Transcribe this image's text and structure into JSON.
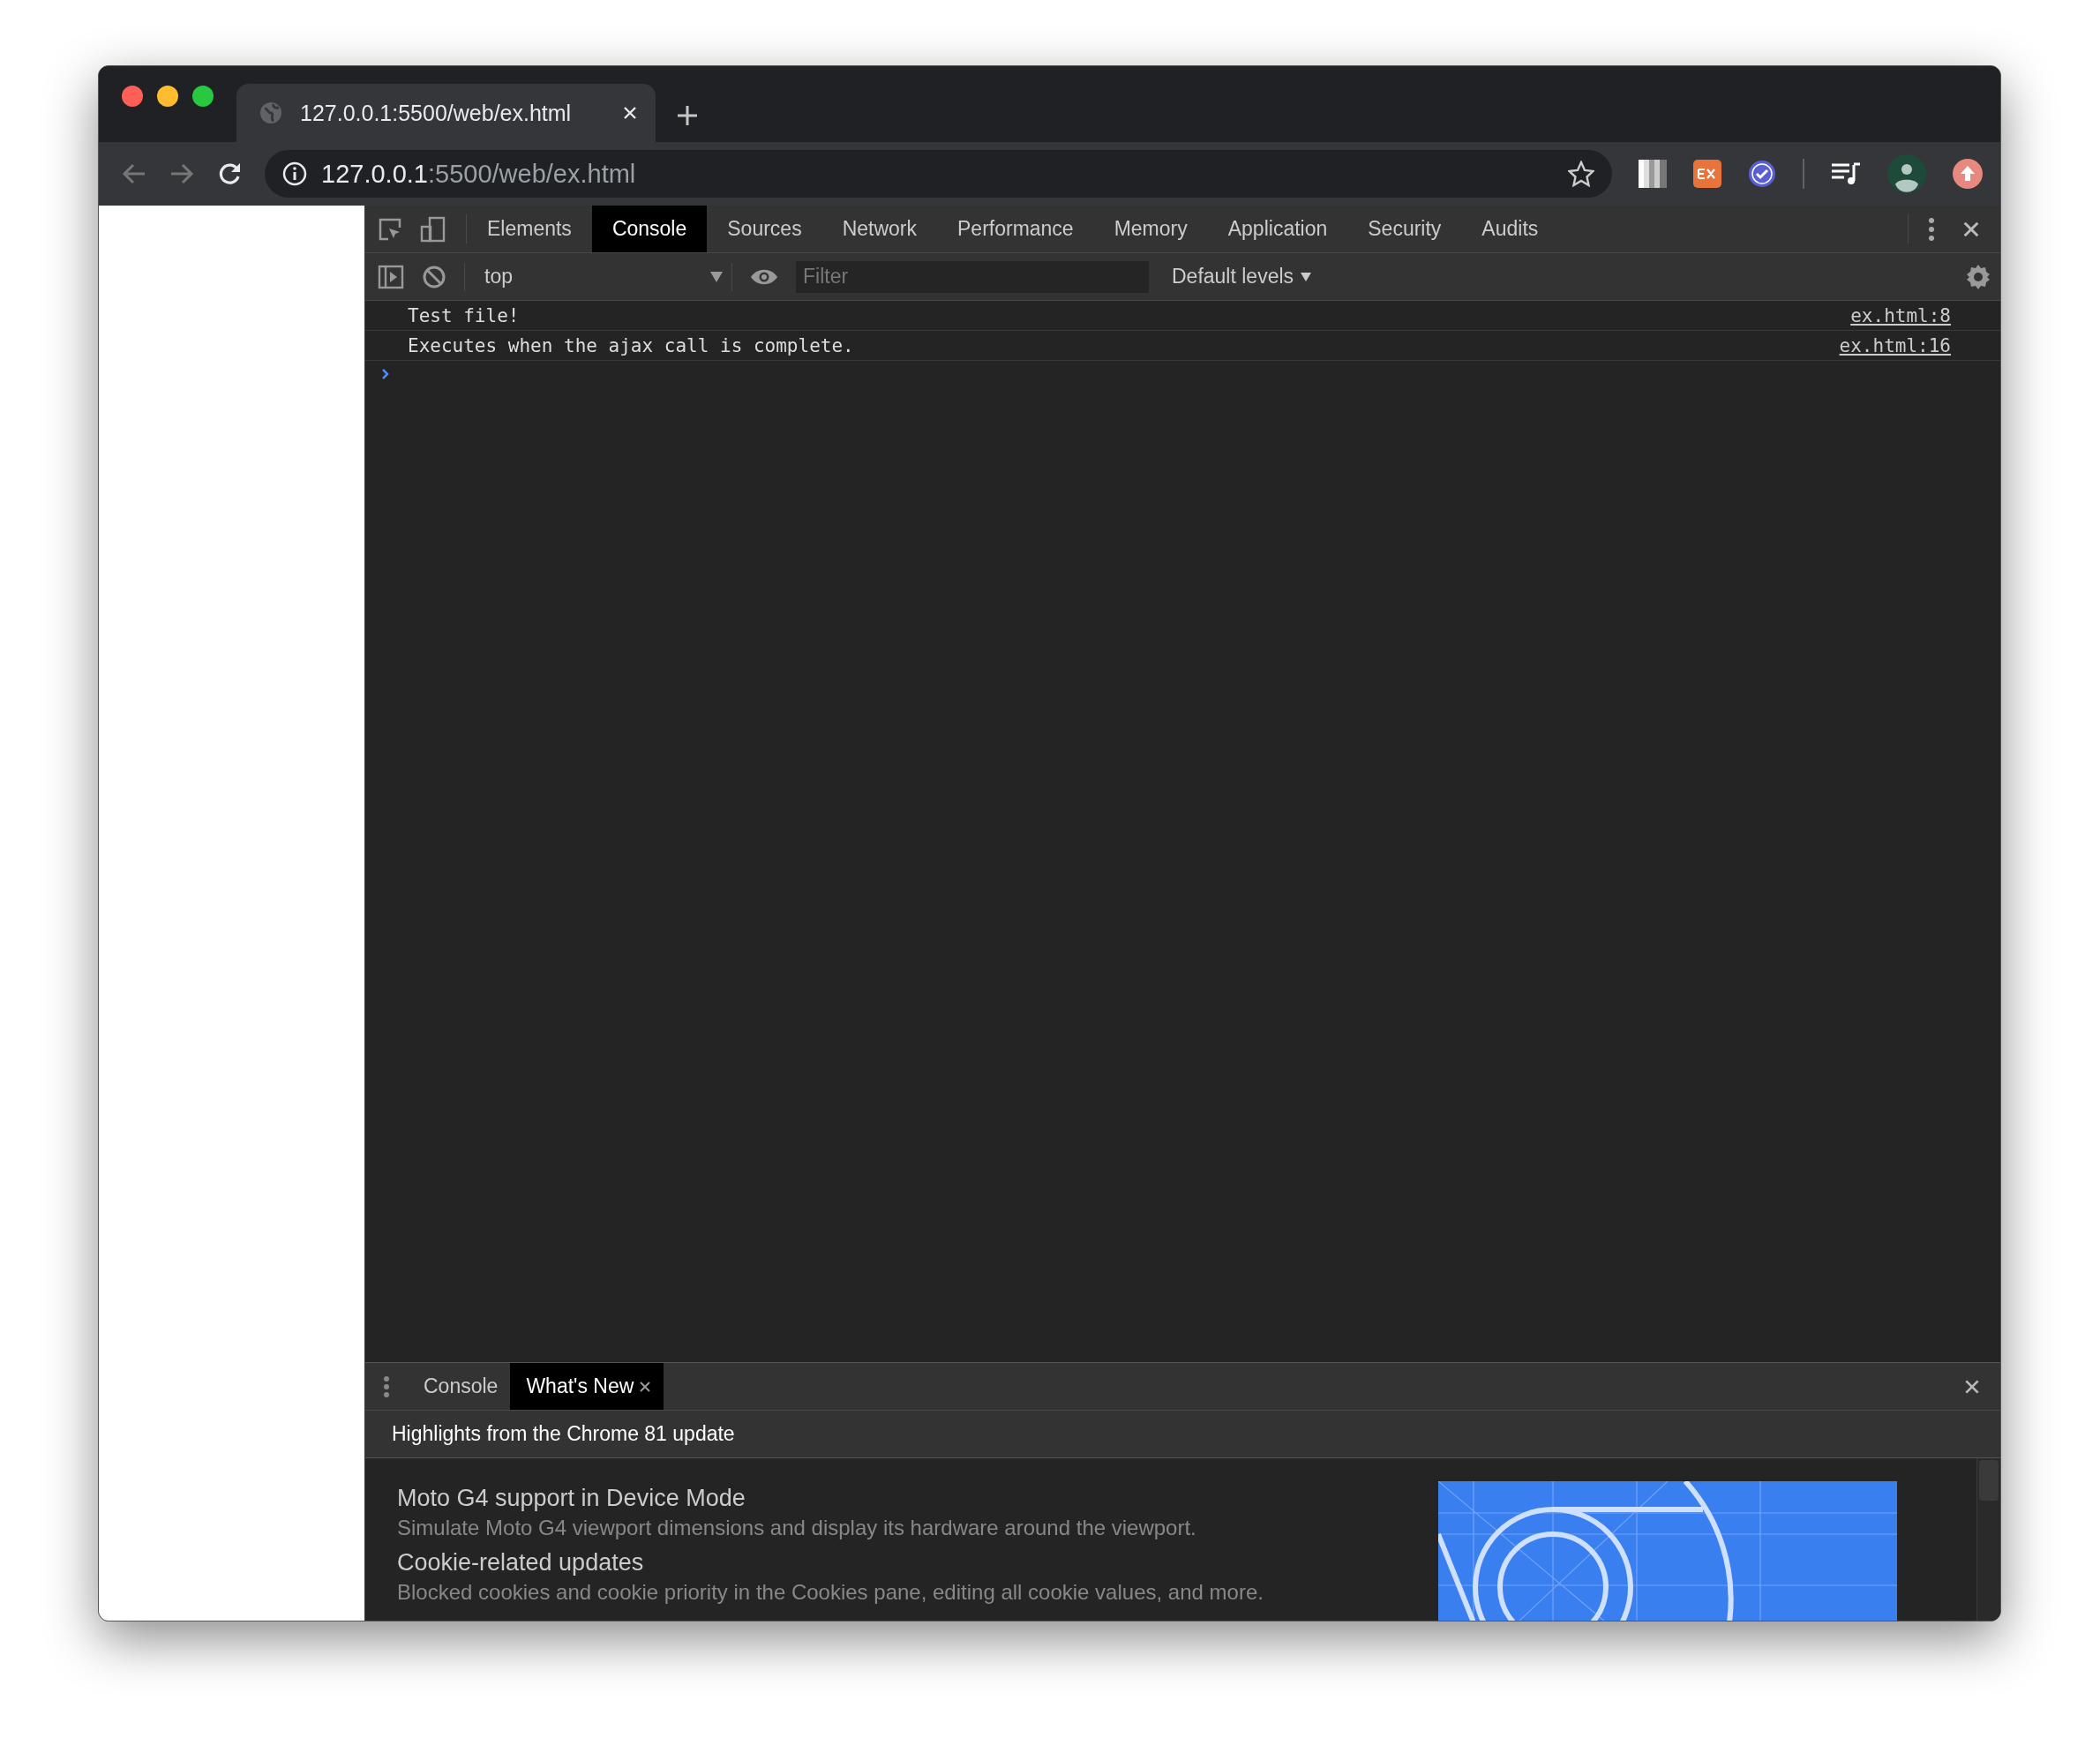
{
  "browser_tab": {
    "title": "127.0.0.1:5500/web/ex.html"
  },
  "address_bar": {
    "host": "127.0.0.1",
    "path": ":5500/web/ex.html"
  },
  "devtools": {
    "tabs": [
      {
        "label": "Elements",
        "selected": false
      },
      {
        "label": "Console",
        "selected": true
      },
      {
        "label": "Sources",
        "selected": false
      },
      {
        "label": "Network",
        "selected": false
      },
      {
        "label": "Performance",
        "selected": false
      },
      {
        "label": "Memory",
        "selected": false
      },
      {
        "label": "Application",
        "selected": false
      },
      {
        "label": "Security",
        "selected": false
      },
      {
        "label": "Audits",
        "selected": false
      }
    ],
    "context": "top",
    "filter": {
      "placeholder": "Filter"
    },
    "levels": "Default levels",
    "messages": [
      {
        "text": "Test file!",
        "source": "ex.html:8"
      },
      {
        "text": "Executes when the ajax call is complete.",
        "source": "ex.html:16"
      }
    ],
    "drawer": {
      "tabs": [
        {
          "label": "Console",
          "selected": false,
          "closable": false
        },
        {
          "label": "What's New",
          "selected": true,
          "closable": true
        }
      ],
      "header": "Highlights from the Chrome 81 update",
      "features": [
        {
          "title": "Moto G4 support in Device Mode",
          "description": "Simulate Moto G4 viewport dimensions and display its hardware around the viewport."
        },
        {
          "title": "Cookie-related updates",
          "description": "Blocked cookies and cookie priority in the Cookies pane, editing all cookie values, and more."
        }
      ]
    }
  }
}
